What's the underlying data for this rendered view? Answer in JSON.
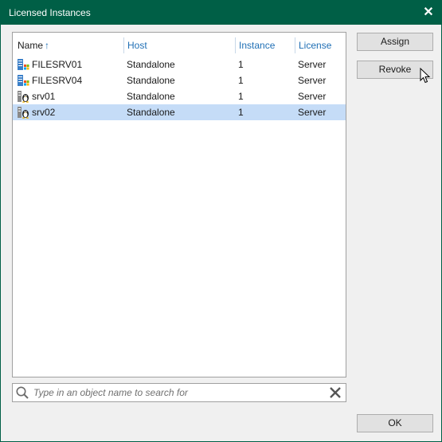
{
  "window": {
    "title": "Licensed Instances",
    "close_icon": "close-icon"
  },
  "columns": [
    {
      "label": "Name",
      "sorted": "ascending"
    },
    {
      "label": "Host"
    },
    {
      "label": "Instance"
    },
    {
      "label": "License"
    }
  ],
  "rows": [
    {
      "icon": "windows-server-icon",
      "name": "FILESRV01",
      "host": "Standalone",
      "instance": "1",
      "license": "Server",
      "selected": false
    },
    {
      "icon": "windows-server-icon",
      "name": "FILESRV04",
      "host": "Standalone",
      "instance": "1",
      "license": "Server",
      "selected": false
    },
    {
      "icon": "linux-server-icon",
      "name": "srv01",
      "host": "Standalone",
      "instance": "1",
      "license": "Server",
      "selected": false
    },
    {
      "icon": "linux-server-icon",
      "name": "srv02",
      "host": "Standalone",
      "instance": "1",
      "license": "Server",
      "selected": true
    }
  ],
  "search": {
    "placeholder": "Type in an object name to search for",
    "value": ""
  },
  "buttons": {
    "assign": "Assign",
    "revoke": "Revoke",
    "ok": "OK"
  },
  "colors": {
    "titlebar": "#005f46",
    "selection": "#c5dcf7",
    "header_text": "#1f6fb5"
  }
}
